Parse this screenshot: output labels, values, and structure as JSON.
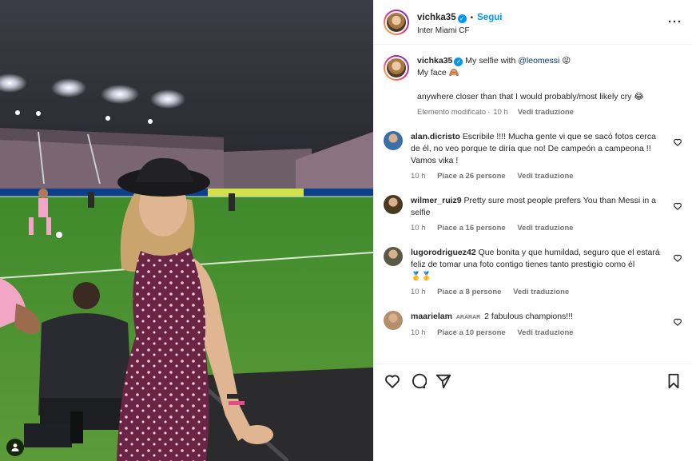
{
  "header": {
    "username": "vichka35",
    "follow_label": "Segui",
    "location": "Inter Miami CF"
  },
  "caption": {
    "username": "vichka35",
    "text_before": "My selfie with",
    "mention": "@leomessi",
    "line2": "My face 🙈",
    "line3": "anywhere closer than that I would probably/most likely cry 😂",
    "edited": "Elemento modificato",
    "time": "10 h",
    "translate": "Vedi traduzione"
  },
  "comments": [
    {
      "username": "alan.dicristo",
      "text": "Escribile !!!! Mucha gente vi que se sacó fotos cerca de él, no veo porque te diría que no! De campeón a campeona !! Vamos vika !",
      "time": "10 h",
      "likes": "Piace a 26 persone",
      "translate": "Vedi traduzione",
      "avatar_color": "#3a6fa8"
    },
    {
      "username": "wilmer_ruiz9",
      "text": "Pretty sure most people prefers You than Messi in a selfie",
      "time": "10 h",
      "likes": "Piace a 16 persone",
      "translate": "Vedi traduzione",
      "avatar_color": "#4a3a22"
    },
    {
      "username": "lugorodriguez42",
      "text": "Que bonita y que humildad, seguro que el estará feliz de tomar una foto contigo tienes tanto prestigio como él",
      "extra": "🥇🥇",
      "time": "10 h",
      "likes": "Piace a 8 persone",
      "translate": "Vedi traduzione",
      "avatar_color": "#5a5a46"
    },
    {
      "username": "maarielam",
      "tag": "ARARAR",
      "text": "2 fabulous champions!!!",
      "time": "10 h",
      "likes": "Piace a 10 persone",
      "translate": "Vedi traduzione",
      "avatar_color": "#b58e6d"
    }
  ],
  "colors": {
    "accent": "#0095f6",
    "muted": "#737373",
    "mention": "#00376b"
  },
  "icons": {
    "like": "heart-icon",
    "comment": "comment-icon",
    "share": "share-icon",
    "save": "bookmark-icon",
    "more": "more-options-icon",
    "user_tag": "user-tag-icon"
  }
}
